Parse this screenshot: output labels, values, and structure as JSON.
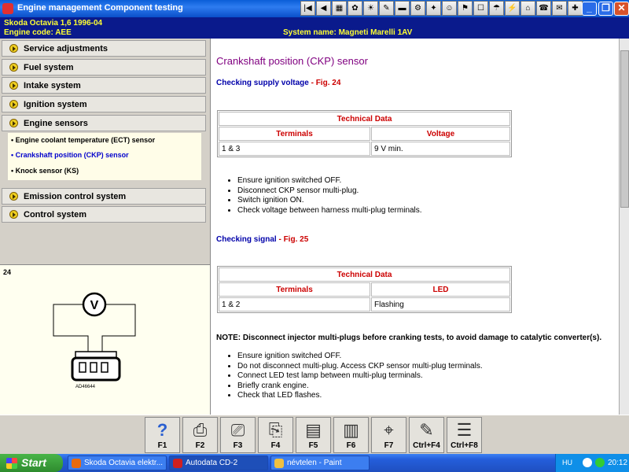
{
  "window": {
    "title": "Engine management Component testing",
    "vehicle": "Skoda   Octavia 1,6   1996-04",
    "engine_code": "Engine code: AEE",
    "system_name": "System name: Magneti Marelli 1AV"
  },
  "toolbar": {
    "icons": [
      "first-page-icon",
      "prev-page-icon",
      "tool-icon-1",
      "tool-icon-2",
      "tool-icon-3",
      "tool-icon-4",
      "tool-icon-5",
      "tool-icon-6",
      "tool-icon-7",
      "tool-icon-8",
      "tool-icon-9",
      "tool-icon-10",
      "tool-icon-11",
      "tool-icon-12",
      "tool-icon-13",
      "tool-icon-14",
      "tool-icon-15",
      "tool-icon-16"
    ]
  },
  "sidebar": {
    "items": [
      {
        "label": "Service adjustments"
      },
      {
        "label": "Fuel system"
      },
      {
        "label": "Intake system"
      },
      {
        "label": "Ignition system"
      },
      {
        "label": "Engine sensors"
      },
      {
        "label": "Emission control system"
      },
      {
        "label": "Control system"
      }
    ],
    "sub_items": [
      {
        "label": "Engine coolant temperature (ECT) sensor"
      },
      {
        "label": "Crankshaft position (CKP) sensor"
      },
      {
        "label": "Knock sensor (KS)"
      }
    ]
  },
  "figure": {
    "number": "24",
    "meter_label": "V",
    "code": "AD46644"
  },
  "content": {
    "title": "Crankshaft position (CKP) sensor",
    "section1": {
      "heading": "Checking supply voltage",
      "sep": " - ",
      "fig": "Fig. 24",
      "table": {
        "header": "Technical Data",
        "col1": "Terminals",
        "col2": "Voltage",
        "row_terminals": "1 & 3",
        "row_value": "9 V min."
      },
      "steps": [
        "Ensure ignition switched OFF.",
        "Disconnect CKP sensor multi-plug.",
        "Switch ignition ON.",
        "Check voltage between harness multi-plug terminals."
      ]
    },
    "section2": {
      "heading": "Checking signal",
      "sep": " - ",
      "fig": "Fig. 25",
      "table": {
        "header": "Technical Data",
        "col1": "Terminals",
        "col2": "LED",
        "row_terminals": "1 & 2",
        "row_value": "Flashing"
      },
      "note": "NOTE: Disconnect injector multi-plugs before cranking tests, to avoid damage to catalytic converter(s).",
      "steps": [
        "Ensure ignition switched OFF.",
        "Do not disconnect multi-plug. Access CKP sensor multi-plug terminals.",
        "Connect LED test lamp between multi-plug terminals.",
        "Briefly crank engine.",
        "Check that LED flashes."
      ]
    }
  },
  "fkeys": [
    {
      "label": "F1",
      "icon": "help-icon"
    },
    {
      "label": "F2",
      "icon": "print-icon"
    },
    {
      "label": "F3",
      "icon": "print-preview-icon"
    },
    {
      "label": "F4",
      "icon": "print-setup-icon"
    },
    {
      "label": "F5",
      "icon": "document-icon"
    },
    {
      "label": "F6",
      "icon": "cards-icon"
    },
    {
      "label": "F7",
      "icon": "probe-icon"
    },
    {
      "label": "Ctrl+F4",
      "icon": "note-icon"
    },
    {
      "label": "Ctrl+F8",
      "icon": "list-icon"
    }
  ],
  "taskbar": {
    "start": "Start",
    "tasks": [
      {
        "label": "Skoda Octavia elektr..."
      },
      {
        "label": "Autodata CD-2"
      },
      {
        "label": "névtelen - Paint"
      }
    ],
    "lang": "HU",
    "clock": "20:12"
  }
}
